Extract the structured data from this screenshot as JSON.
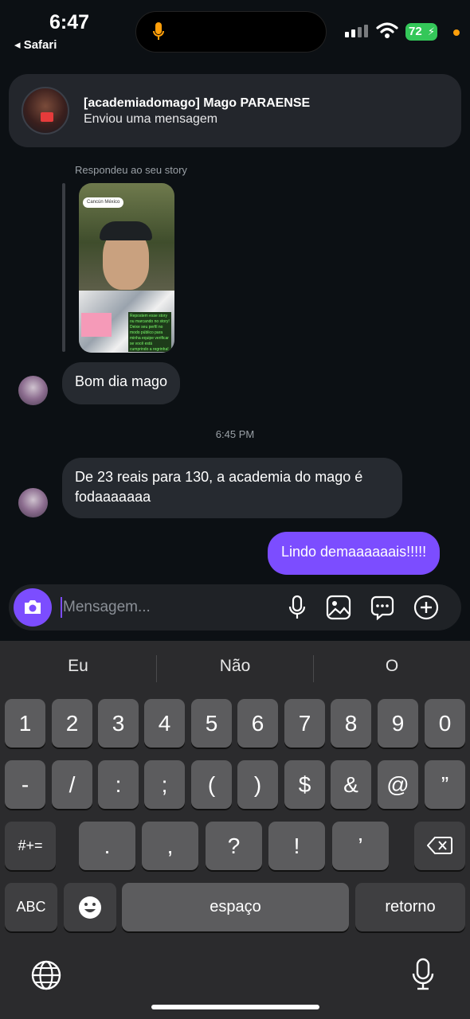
{
  "status_bar": {
    "time": "6:47",
    "back_label": "◂ Safari",
    "battery_percent": "72",
    "icons": [
      "microphone-icon",
      "signal-icon",
      "wifi-icon",
      "battery-icon",
      "privacy-dot"
    ],
    "colors": {
      "battery": "#34c759",
      "privacy_dot": "#ff9f0a",
      "mic": "#ff9f0a"
    }
  },
  "notification": {
    "title": "[academiadomago] Mago PARAENSE",
    "subtitle": "Enviou uma mensagem"
  },
  "chat": {
    "reply_label": "Respondeu ao seu story",
    "story": {
      "location_chip": "Cancún México",
      "note_text": "Repostem esse story ou marcando no story! Deixe seu perfil no modo público para minha equipe verificar se você está cumprindo a regrinha!"
    },
    "messages": [
      {
        "from": "them",
        "text": "Bom dia mago"
      },
      {
        "from": "them",
        "text": "De 23 reais para 130, a academia do mago é fodaaaaaaa"
      },
      {
        "from": "me",
        "text": "Lindo demaaaaaais!!!!!"
      }
    ],
    "timestamp": "6:45 PM",
    "accent_color": "#7c4dff"
  },
  "composer": {
    "placeholder": "Mensagem...",
    "icons": [
      "camera-icon",
      "microphone-icon",
      "gallery-icon",
      "sticker-icon",
      "plus-icon"
    ]
  },
  "keyboard": {
    "suggestions": [
      "Eu",
      "Não",
      "O"
    ],
    "row1": [
      "1",
      "2",
      "3",
      "4",
      "5",
      "6",
      "7",
      "8",
      "9",
      "0"
    ],
    "row2": [
      "-",
      "/",
      ":",
      ";",
      "(",
      ")",
      "$",
      "&",
      "@",
      "”"
    ],
    "row3_left": "#+=",
    "row3": [
      ".",
      ",",
      "?",
      "!",
      "’"
    ],
    "abc": "ABC",
    "space": "espaço",
    "return": "retorno",
    "icons": [
      "backspace-icon",
      "emoji-icon",
      "globe-icon",
      "dictation-icon"
    ]
  }
}
